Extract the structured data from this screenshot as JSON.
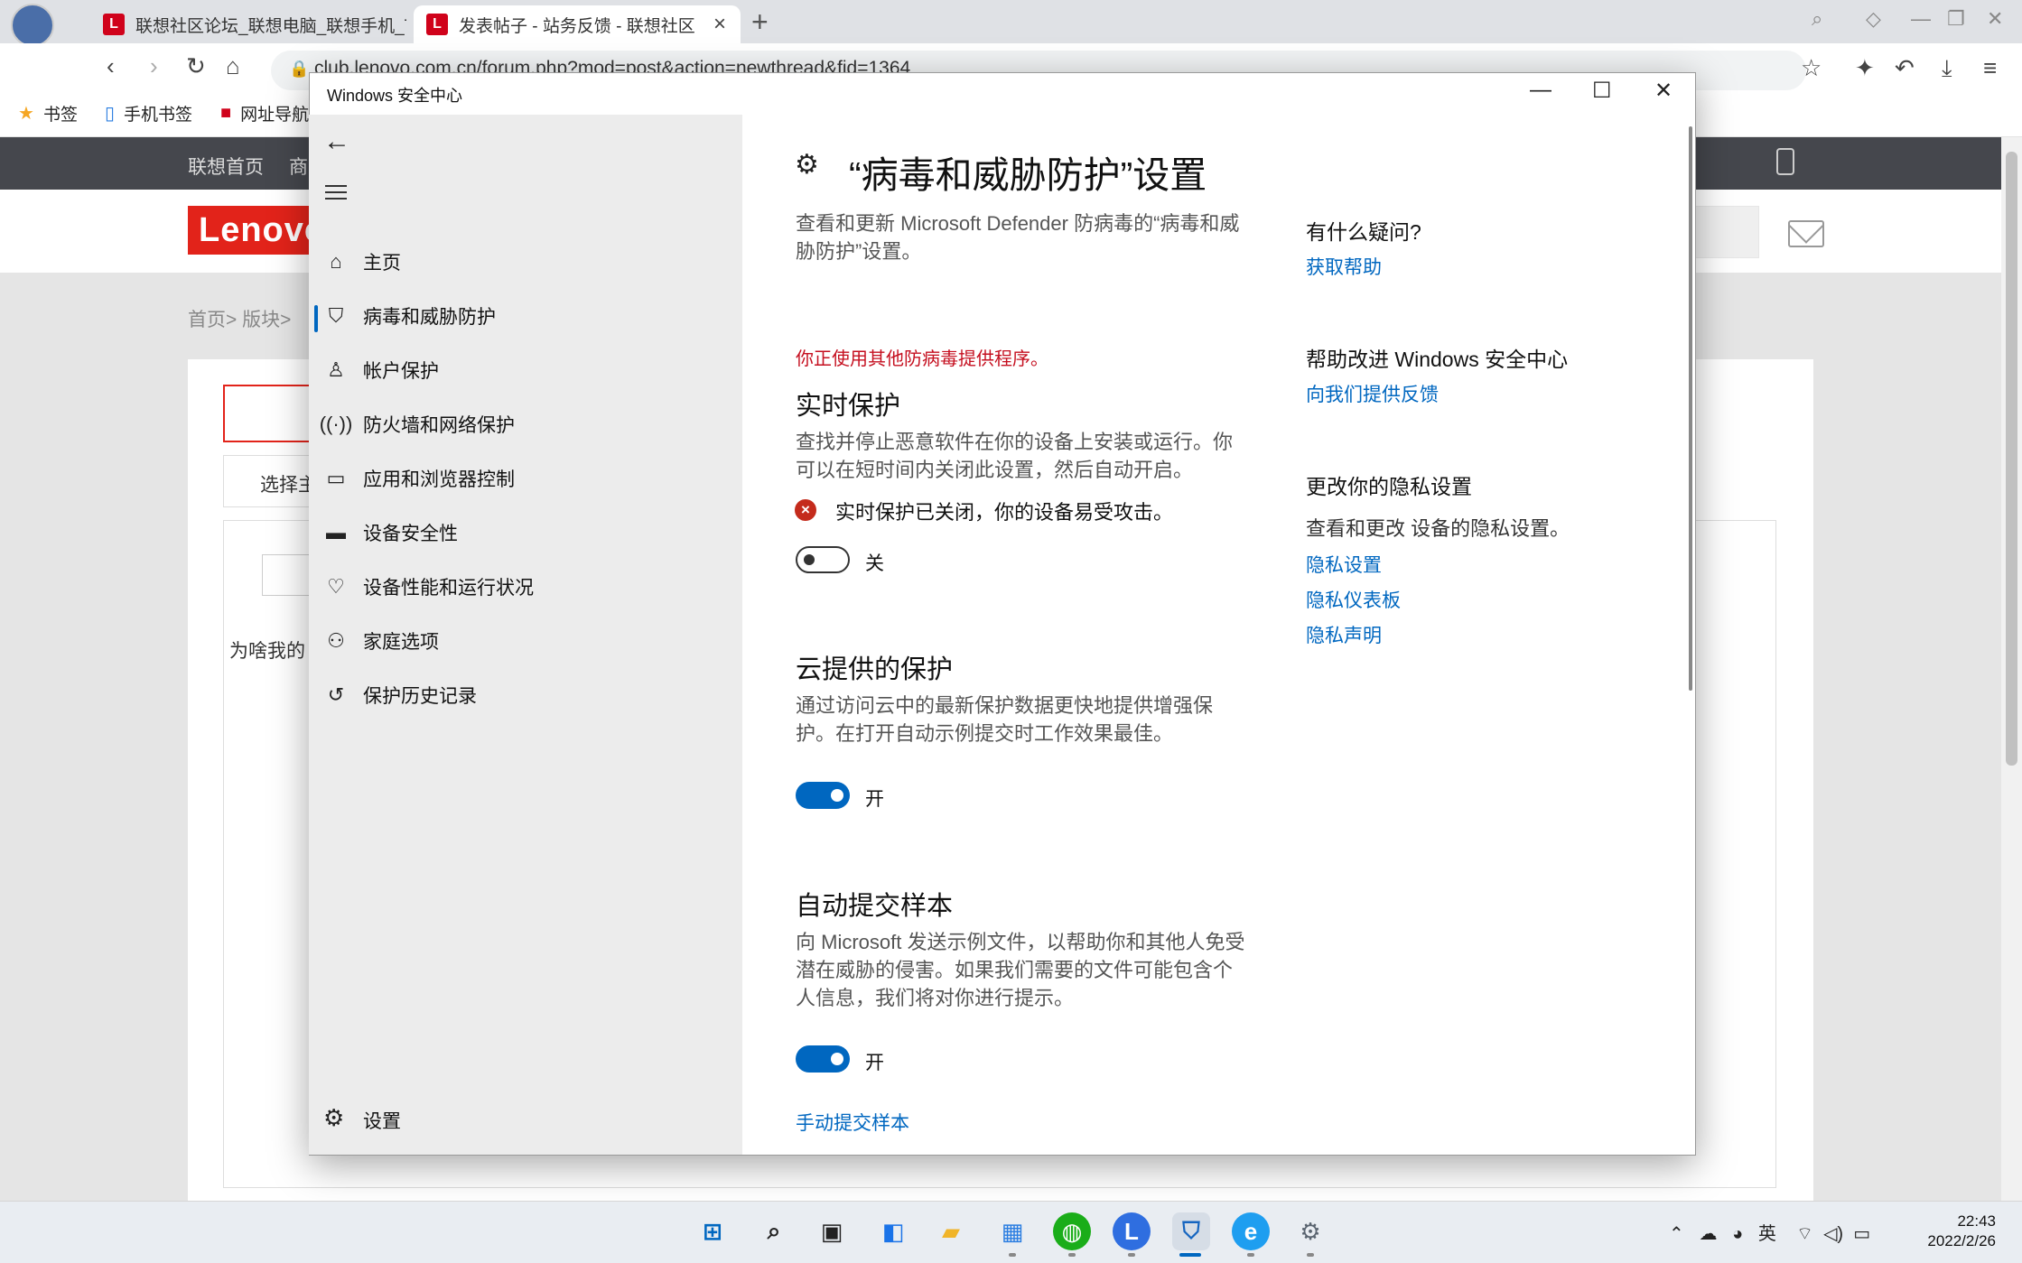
{
  "browser": {
    "tabs": [
      {
        "label": "联想社区论坛_联想电脑_联想手机_T"
      },
      {
        "label": "发表帖子 - 站务反馈 - 联想社区"
      }
    ],
    "url": "club.lenovo.com.cn/forum.php?mod=post&action=newthread&fid=1364",
    "bookmarks": [
      "书签",
      "手机书签",
      "网址导航"
    ]
  },
  "site": {
    "nav": [
      "联想首页",
      "商"
    ],
    "logo_text": "Lenovo",
    "breadcrumb": "首页>  版块>",
    "choose_label": "选择主",
    "question_fragment": "为啥我的"
  },
  "security_window": {
    "title": "Windows 安全中心",
    "nav_items": [
      {
        "label": "主页",
        "icon": "home-icon"
      },
      {
        "label": "病毒和威胁防护",
        "icon": "shield-icon"
      },
      {
        "label": "帐户保护",
        "icon": "person-icon"
      },
      {
        "label": "防火墙和网络保护",
        "icon": "wifi-icon"
      },
      {
        "label": "应用和浏览器控制",
        "icon": "app-window-icon"
      },
      {
        "label": "设备安全性",
        "icon": "laptop-icon"
      },
      {
        "label": "设备性能和运行状况",
        "icon": "heart-icon"
      },
      {
        "label": "家庭选项",
        "icon": "family-icon"
      },
      {
        "label": "保护历史记录",
        "icon": "history-icon"
      }
    ],
    "settings_label": "设置",
    "main": {
      "title": "“病毒和威胁防护”设置",
      "description": "查看和更新 Microsoft Defender 防病毒的“病毒和威胁防护”设置。",
      "warning": "你正使用其他防病毒提供程序。",
      "realtime": {
        "title": "实时保护",
        "description": "查找并停止恶意软件在你的设备上安装或运行。你可以在短时间内关闭此设置，然后自动开启。",
        "error": "实时保护已关闭，你的设备易受攻击。",
        "state": "关"
      },
      "cloud": {
        "title": "云提供的保护",
        "description": "通过访问云中的最新保护数据更快地提供增强保护。在打开自动示例提交时工作效果最佳。",
        "state": "开"
      },
      "autosubmit": {
        "title": "自动提交样本",
        "description": "向 Microsoft 发送示例文件，以帮助你和其他人免受潜在威胁的侵害。如果我们需要的文件可能包含个人信息，我们将对你进行提示。",
        "state": "开",
        "manual_link": "手动提交样本"
      }
    },
    "side": {
      "question_title": "有什么疑问?",
      "help_link": "获取帮助",
      "improve_title": "帮助改进 Windows 安全中心",
      "feedback_link": "向我们提供反馈",
      "privacy_title": "更改你的隐私设置",
      "privacy_desc": "查看和更改 设备的隐私设置。",
      "privacy_links": [
        "隐私设置",
        "隐私仪表板",
        "隐私声明"
      ]
    }
  },
  "taskbar": {
    "tray_lang": "英",
    "time": "22:43",
    "date": "2022/2/26"
  },
  "colors": {
    "accent": "#0067c0",
    "error": "#c42b1c",
    "lenovo_red": "#e2231a"
  }
}
